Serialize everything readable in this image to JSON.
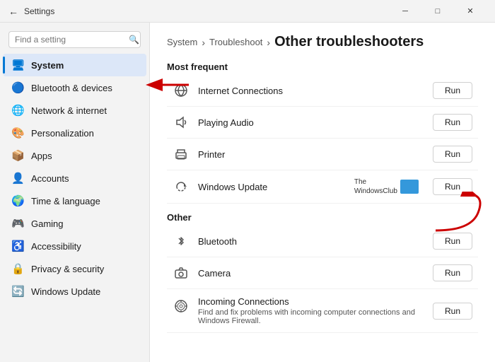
{
  "titlebar": {
    "title": "Settings",
    "back_icon": "←",
    "min_label": "─",
    "max_label": "□",
    "close_label": "✕"
  },
  "sidebar": {
    "search_placeholder": "Find a setting",
    "search_icon": "🔍",
    "items": [
      {
        "id": "system",
        "label": "System",
        "icon": "💻",
        "active": true
      },
      {
        "id": "bluetooth",
        "label": "Bluetooth & devices",
        "icon": "🔵"
      },
      {
        "id": "network",
        "label": "Network & internet",
        "icon": "🌐"
      },
      {
        "id": "personalization",
        "label": "Personalization",
        "icon": "🎨"
      },
      {
        "id": "apps",
        "label": "Apps",
        "icon": "📦"
      },
      {
        "id": "accounts",
        "label": "Accounts",
        "icon": "👤"
      },
      {
        "id": "time",
        "label": "Time & language",
        "icon": "🌍"
      },
      {
        "id": "gaming",
        "label": "Gaming",
        "icon": "🎮"
      },
      {
        "id": "accessibility",
        "label": "Accessibility",
        "icon": "♿"
      },
      {
        "id": "privacy",
        "label": "Privacy & security",
        "icon": "🔒"
      },
      {
        "id": "update",
        "label": "Windows Update",
        "icon": "🔄"
      }
    ]
  },
  "breadcrumb": {
    "parts": [
      "System",
      "Troubleshoot"
    ],
    "current": "Other troubleshooters"
  },
  "most_frequent": {
    "label": "Most frequent",
    "items": [
      {
        "id": "internet",
        "icon": "📶",
        "name": "Internet Connections",
        "run_label": "Run"
      },
      {
        "id": "audio",
        "icon": "🔊",
        "name": "Playing Audio",
        "run_label": "Run"
      },
      {
        "id": "printer",
        "icon": "🖨",
        "name": "Printer",
        "run_label": "Run"
      },
      {
        "id": "winupdate",
        "icon": "🔃",
        "name": "Windows Update",
        "run_label": "Run"
      }
    ]
  },
  "other": {
    "label": "Other",
    "items": [
      {
        "id": "bluetooth",
        "icon": "✴",
        "name": "Bluetooth",
        "run_label": "Run"
      },
      {
        "id": "camera",
        "icon": "📷",
        "name": "Camera",
        "run_label": "Run"
      },
      {
        "id": "incoming",
        "icon": "📡",
        "name": "Incoming Connections",
        "desc": "Find and fix problems with incoming computer connections and Windows Firewall.",
        "run_label": "Run"
      }
    ]
  },
  "watermark": {
    "text1": "The",
    "text2": "WindowsClub"
  }
}
